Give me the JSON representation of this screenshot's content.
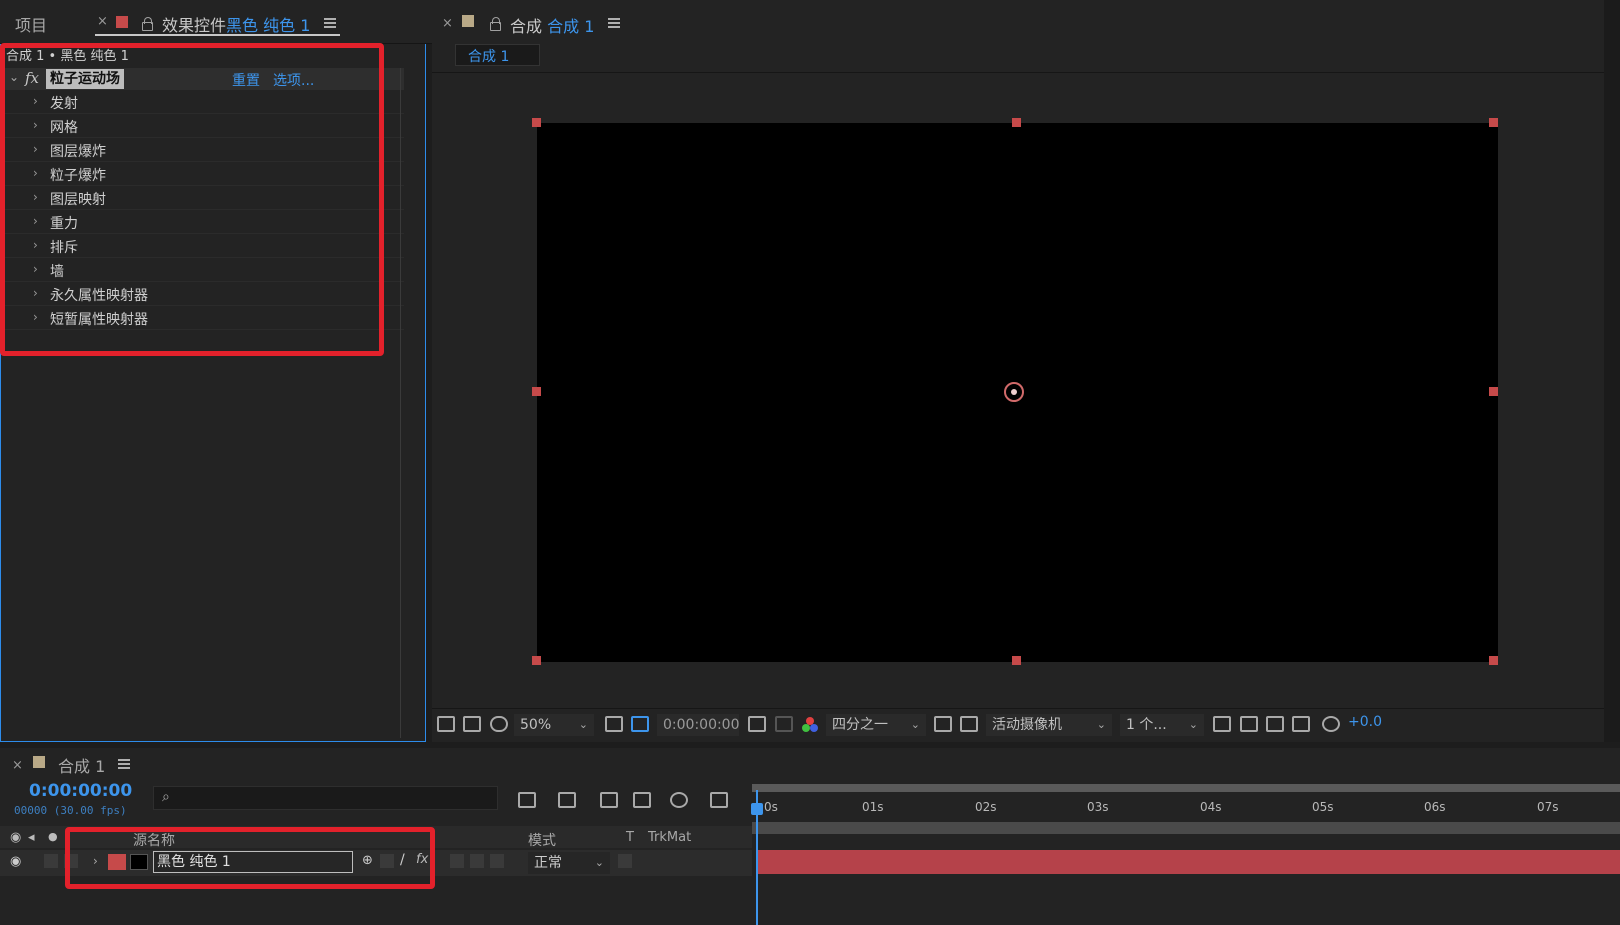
{
  "project_tab": {
    "label": "项目"
  },
  "effects_tab": {
    "label_prefix": "效果控件",
    "layer_name": "黑色 纯色 1"
  },
  "effects_header": "合成 1 • 黑色 纯色 1",
  "effect": {
    "fx_label": "fx",
    "name": "粒子运动场",
    "reset": "重置",
    "options": "选项...",
    "properties": [
      "发射",
      "网格",
      "图层爆炸",
      "粒子爆炸",
      "图层映射",
      "重力",
      "排斥",
      "墙",
      "永久属性映射器",
      "短暂属性映射器"
    ]
  },
  "viewer": {
    "tab_prefix": "合成",
    "tab_comp": "合成 1",
    "breadcrumb": "合成 1",
    "toolbar": {
      "zoom": "50%",
      "timecode": "0:00:00:00",
      "resolution": "四分之一",
      "camera": "活动摄像机",
      "views": "1 个...",
      "exposure": "+0.0"
    }
  },
  "timeline": {
    "tab_label": "合成 1",
    "timecode": "0:00:00:00",
    "frame_info": "00000 (30.00 fps)",
    "columns": {
      "source_name": "源名称",
      "mode": "模式",
      "t": "T",
      "trkmat": "TrkMat"
    },
    "ruler": [
      "0s",
      "01s",
      "02s",
      "03s",
      "04s",
      "05s",
      "06s",
      "07s"
    ],
    "layer": {
      "name": "黑色 纯色 1",
      "mode": "正常"
    }
  },
  "colors": {
    "accent": "#2d8ceb",
    "highlight_box": "#e3212b",
    "layer_label": "#c64a4a",
    "layer_bar": "#b5424a"
  }
}
